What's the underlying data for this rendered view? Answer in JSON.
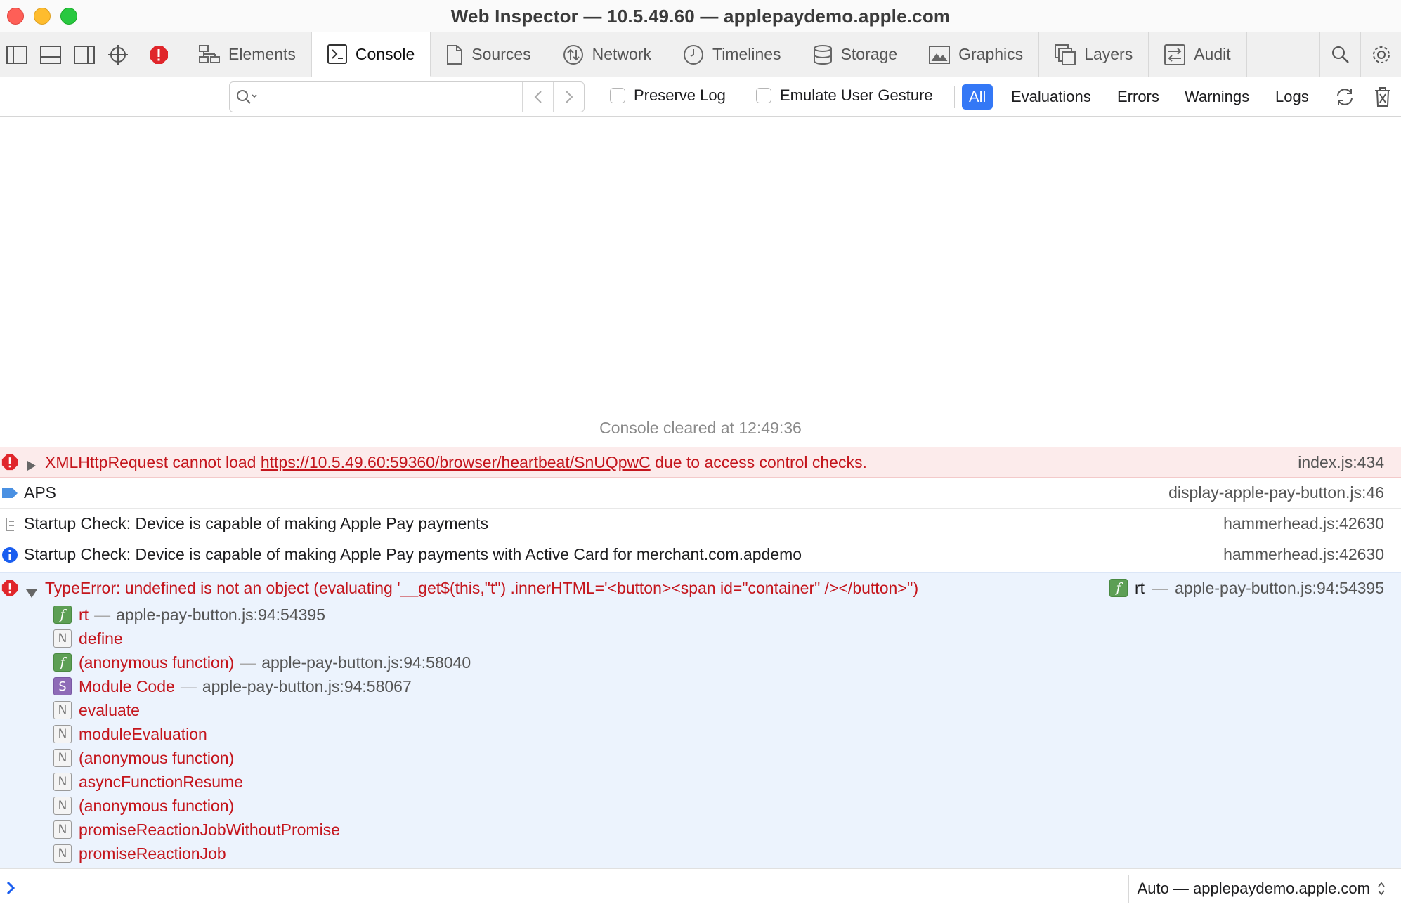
{
  "window": {
    "title": "Web Inspector — 10.5.49.60 — applepaydemo.apple.com"
  },
  "tabs": [
    {
      "label": "Elements"
    },
    {
      "label": "Console"
    },
    {
      "label": "Sources"
    },
    {
      "label": "Network"
    },
    {
      "label": "Timelines"
    },
    {
      "label": "Storage"
    },
    {
      "label": "Graphics"
    },
    {
      "label": "Layers"
    },
    {
      "label": "Audit"
    }
  ],
  "active_tab": "Console",
  "filter": {
    "search_placeholder": "",
    "preserve_log": "Preserve Log",
    "emulate_gesture": "Emulate User Gesture",
    "levels": [
      "All",
      "Evaluations",
      "Errors",
      "Warnings",
      "Logs"
    ],
    "selected_level": "All"
  },
  "console": {
    "cleared": "Console cleared at 12:49:36",
    "messages": [
      {
        "text_pre": "XMLHttpRequest cannot load ",
        "link": "https://10.5.49.60:59360/browser/heartbeat/SnUQpwC",
        "text_post": " due to access control checks.",
        "source": "index.js:434"
      },
      {
        "text": "APS",
        "source": "display-apple-pay-button.js:46"
      },
      {
        "text": "Startup Check: Device is capable of making Apple Pay payments",
        "source": "hammerhead.js:42630"
      },
      {
        "text": "Startup Check: Device is capable of making Apple Pay payments with Active Card for merchant.com.apdemo",
        "source": "hammerhead.js:42630"
      },
      {
        "text": "TypeError: undefined is not an object (evaluating '__get$(this,\"t\") .innerHTML='<button><span id=\"container\" /></button>'')",
        "source_fn": "rt",
        "source": "apple-pay-button.js:94:54395"
      }
    ],
    "stack": [
      {
        "badge": "f",
        "fn": "rt",
        "loc": "apple-pay-button.js:94:54395"
      },
      {
        "badge": "N",
        "fn": "define",
        "loc": ""
      },
      {
        "badge": "f",
        "fn": "(anonymous function)",
        "loc": "apple-pay-button.js:94:58040"
      },
      {
        "badge": "S",
        "fn": "Module Code",
        "loc": "apple-pay-button.js:94:58067"
      },
      {
        "badge": "N",
        "fn": "evaluate",
        "loc": ""
      },
      {
        "badge": "N",
        "fn": "moduleEvaluation",
        "loc": ""
      },
      {
        "badge": "N",
        "fn": "(anonymous function)",
        "loc": ""
      },
      {
        "badge": "N",
        "fn": "asyncFunctionResume",
        "loc": ""
      },
      {
        "badge": "N",
        "fn": "(anonymous function)",
        "loc": ""
      },
      {
        "badge": "N",
        "fn": "promiseReactionJobWithoutPromise",
        "loc": ""
      },
      {
        "badge": "N",
        "fn": "promiseReactionJob",
        "loc": ""
      }
    ],
    "dash": "—"
  },
  "prompt": {
    "context": "Auto — applepaydemo.apple.com"
  },
  "colors": {
    "accent": "#3478f6",
    "error": "#c4151c",
    "error_bg": "#fcebeb",
    "trace_bg": "#ecf3fd"
  }
}
